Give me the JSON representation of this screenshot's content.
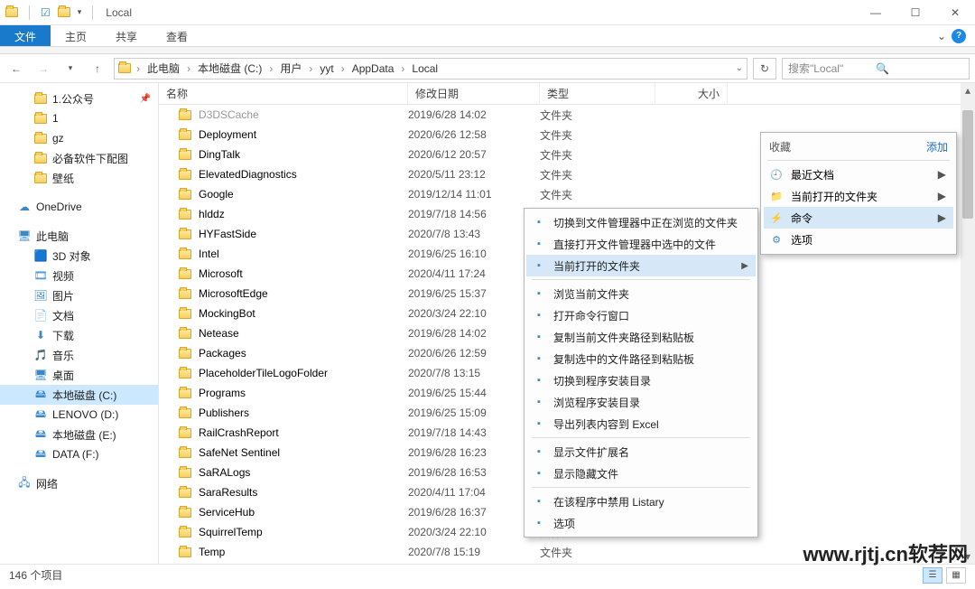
{
  "window": {
    "title": "Local"
  },
  "ribbon": {
    "tabs": {
      "file": "文件",
      "home": "主页",
      "share": "共享",
      "view": "查看"
    }
  },
  "breadcrumb": [
    "此电脑",
    "本地磁盘 (C:)",
    "用户",
    "yyt",
    "AppData",
    "Local"
  ],
  "search": {
    "placeholder": "搜索\"Local\""
  },
  "columns": {
    "name": "名称",
    "date": "修改日期",
    "type": "类型",
    "size": "大小"
  },
  "tree": {
    "quick": [
      {
        "label": "1.公众号",
        "pin": true
      },
      {
        "label": "1",
        "pin": false
      },
      {
        "label": "gz",
        "pin": false
      },
      {
        "label": "必备软件下配图",
        "pin": false
      },
      {
        "label": "壁纸",
        "pin": false
      }
    ],
    "onedrive": "OneDrive",
    "thispc": "此电脑",
    "pc": [
      {
        "label": "3D 对象"
      },
      {
        "label": "视频"
      },
      {
        "label": "图片"
      },
      {
        "label": "文档"
      },
      {
        "label": "下载"
      },
      {
        "label": "音乐"
      },
      {
        "label": "桌面"
      },
      {
        "label": "本地磁盘 (C:)",
        "selected": true
      },
      {
        "label": "LENOVO (D:)"
      },
      {
        "label": "本地磁盘 (E:)"
      },
      {
        "label": "DATA (F:)"
      }
    ],
    "network": "网络"
  },
  "rows": [
    {
      "name": "D3DSCache",
      "date": "2019/6/28 14:02",
      "type": "文件夹",
      "clipped": true
    },
    {
      "name": "Deployment",
      "date": "2020/6/26 12:58",
      "type": "文件夹"
    },
    {
      "name": "DingTalk",
      "date": "2020/6/12 20:57",
      "type": "文件夹"
    },
    {
      "name": "ElevatedDiagnostics",
      "date": "2020/5/11 23:12",
      "type": "文件夹"
    },
    {
      "name": "Google",
      "date": "2019/12/14 11:01",
      "type": "文件夹"
    },
    {
      "name": "hlddz",
      "date": "2019/7/18 14:56",
      "type": "文件夹"
    },
    {
      "name": "HYFastSide",
      "date": "2020/7/8 13:43",
      "type": ""
    },
    {
      "name": "Intel",
      "date": "2019/6/25 16:10",
      "type": ""
    },
    {
      "name": "Microsoft",
      "date": "2020/4/11 17:24",
      "type": ""
    },
    {
      "name": "MicrosoftEdge",
      "date": "2019/6/25 15:37",
      "type": ""
    },
    {
      "name": "MockingBot",
      "date": "2020/3/24 22:10",
      "type": ""
    },
    {
      "name": "Netease",
      "date": "2019/6/28 14:02",
      "type": ""
    },
    {
      "name": "Packages",
      "date": "2020/6/26 12:59",
      "type": ""
    },
    {
      "name": "PlaceholderTileLogoFolder",
      "date": "2020/7/8 13:15",
      "type": ""
    },
    {
      "name": "Programs",
      "date": "2019/6/25 15:44",
      "type": ""
    },
    {
      "name": "Publishers",
      "date": "2019/6/25 15:09",
      "type": ""
    },
    {
      "name": "RailCrashReport",
      "date": "2019/7/18 14:43",
      "type": ""
    },
    {
      "name": "SafeNet Sentinel",
      "date": "2019/6/28 16:23",
      "type": ""
    },
    {
      "name": "SaRALogs",
      "date": "2019/6/28 16:53",
      "type": ""
    },
    {
      "name": "SaraResults",
      "date": "2020/4/11 17:04",
      "type": ""
    },
    {
      "name": "ServiceHub",
      "date": "2019/6/28 16:37",
      "type": ""
    },
    {
      "name": "SquirrelTemp",
      "date": "2020/3/24 22:10",
      "type": "文件夹"
    },
    {
      "name": "Temp",
      "date": "2020/7/8 15:19",
      "type": "文件夹"
    }
  ],
  "status": {
    "count": "146 个项目"
  },
  "ctx1": {
    "g1": [
      {
        "label": "切换到文件管理器中正在浏览的文件夹"
      },
      {
        "label": "直接打开文件管理器中选中的文件"
      },
      {
        "label": "当前打开的文件夹",
        "arrow": true,
        "hover": true
      }
    ],
    "g2": [
      {
        "label": "浏览当前文件夹"
      },
      {
        "label": "打开命令行窗口"
      },
      {
        "label": "复制当前文件夹路径到粘贴板"
      },
      {
        "label": "复制选中的文件路径到粘贴板"
      },
      {
        "label": "切换到程序安装目录"
      },
      {
        "label": "浏览程序安装目录"
      },
      {
        "label": "导出列表内容到 Excel"
      }
    ],
    "g3": [
      {
        "label": "显示文件扩展名"
      },
      {
        "label": "显示隐藏文件"
      }
    ],
    "g4": [
      {
        "label": "在该程序中禁用 Listary"
      },
      {
        "label": "选项"
      }
    ]
  },
  "panel2": {
    "head": "收藏",
    "add": "添加",
    "items": [
      {
        "label": "最近文档",
        "arrow": true
      },
      {
        "label": "当前打开的文件夹",
        "arrow": true
      },
      {
        "label": "命令",
        "arrow": true,
        "hover": true
      },
      {
        "label": "选项"
      }
    ]
  },
  "watermark": "www.rjtj.cn软荐网"
}
